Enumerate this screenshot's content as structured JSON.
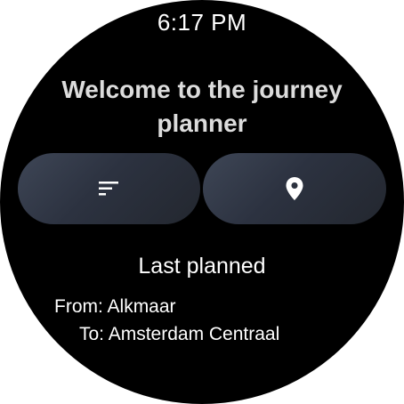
{
  "status_bar": {
    "time": "6:17 PM"
  },
  "welcome": {
    "title": "Welcome to the journey planner"
  },
  "actions": {
    "left_icon": "sort-list-icon",
    "right_icon": "location-pin-icon"
  },
  "last_planned": {
    "heading": "Last planned",
    "from_prefix": "From:",
    "from_value": "Alkmaar",
    "to_prefix": "To:",
    "to_value": "Amsterdam Centraal"
  },
  "colors": {
    "background": "#000000",
    "button": "#2c3240",
    "text": "#ffffff",
    "title_text": "#dcdcdc"
  }
}
